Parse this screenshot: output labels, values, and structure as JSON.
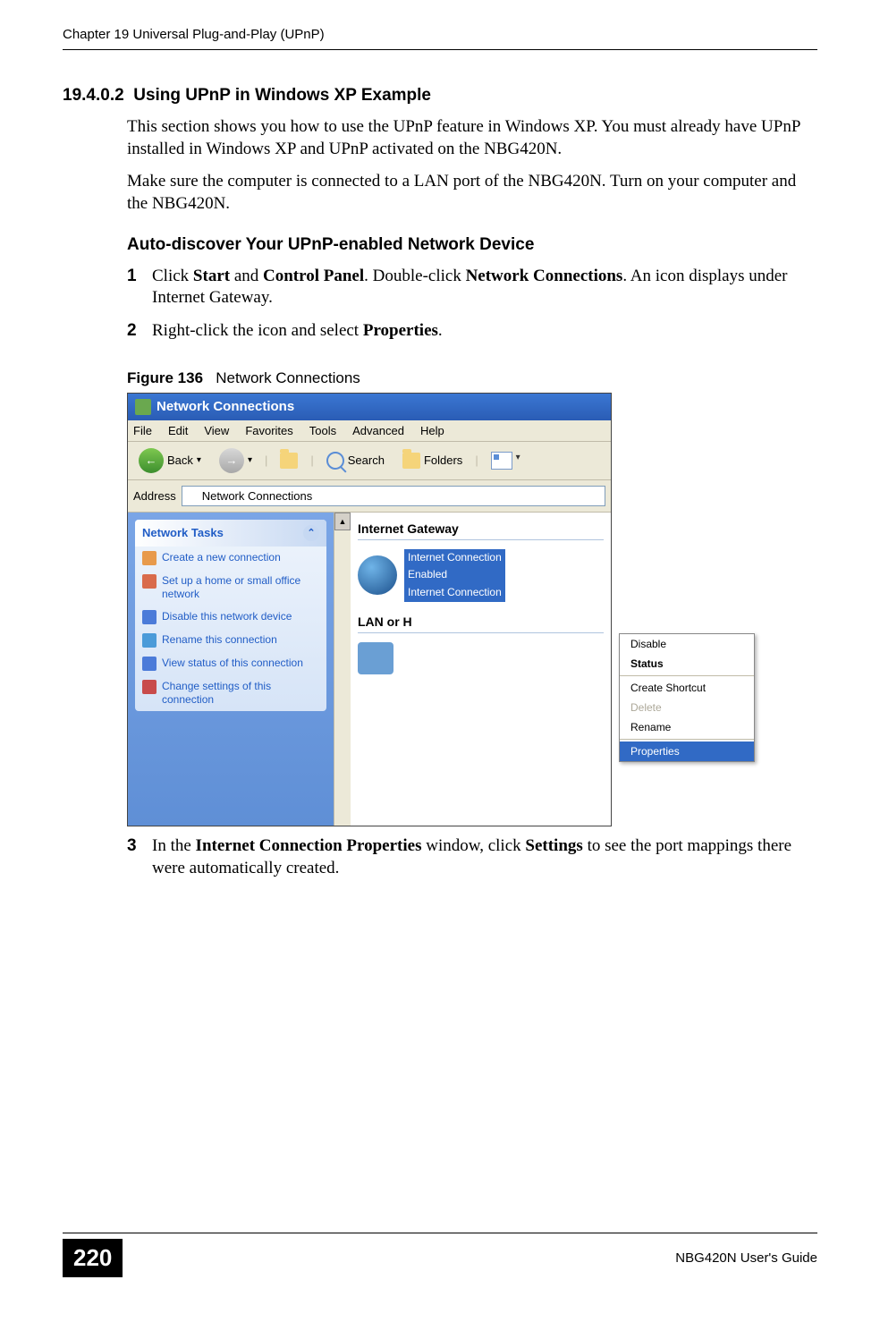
{
  "header": {
    "chapter": "Chapter 19 Universal Plug-and-Play (UPnP)"
  },
  "section": {
    "number": "19.4.0.2",
    "title": "Using UPnP in Windows XP Example",
    "para1": "This section shows you how to use the UPnP feature in Windows XP. You must already have UPnP installed in Windows XP and UPnP activated on the NBG420N.",
    "para2": "Make sure the computer is connected to a LAN port of the NBG420N. Turn on your computer and the NBG420N."
  },
  "subheading": "Auto-discover Your UPnP-enabled Network Device",
  "steps": {
    "s1": {
      "n": "1",
      "pre": "Click ",
      "b1": "Start",
      "mid1": " and ",
      "b2": "Control Panel",
      "mid2": ". Double-click ",
      "b3": "Network Connections",
      "post": ". An icon displays under Internet Gateway."
    },
    "s2": {
      "n": "2",
      "pre": "Right-click the icon and select ",
      "b1": "Properties",
      "post": "."
    },
    "s3": {
      "n": "3",
      "pre": "In the ",
      "b1": "Internet Connection Properties",
      "mid1": " window, click ",
      "b2": "Settings",
      "post": " to see the port mappings there were automatically created."
    }
  },
  "figure": {
    "label": "Figure 136",
    "caption": "Network Connections"
  },
  "screenshot": {
    "title": "Network Connections",
    "menu": [
      "File",
      "Edit",
      "View",
      "Favorites",
      "Tools",
      "Advanced",
      "Help"
    ],
    "toolbar": {
      "back": "Back",
      "search": "Search",
      "folders": "Folders"
    },
    "address_label": "Address",
    "address_value": "Network Connections",
    "tasks_header": "Network Tasks",
    "tasks": [
      "Create a new connection",
      "Set up a home or small office network",
      "Disable this network device",
      "Rename this connection",
      "View status of this connection",
      "Change settings of this connection"
    ],
    "group1": "Internet Gateway",
    "conn_label_l1": "Internet Connection",
    "conn_label_l2": "Enabled",
    "conn_label_l3": "Internet Connection",
    "group2": "LAN or H",
    "context_menu": {
      "disable": "Disable",
      "status": "Status",
      "create_shortcut": "Create Shortcut",
      "delete": "Delete",
      "rename": "Rename",
      "properties": "Properties"
    }
  },
  "footer": {
    "page": "220",
    "guide": "NBG420N User's Guide"
  }
}
